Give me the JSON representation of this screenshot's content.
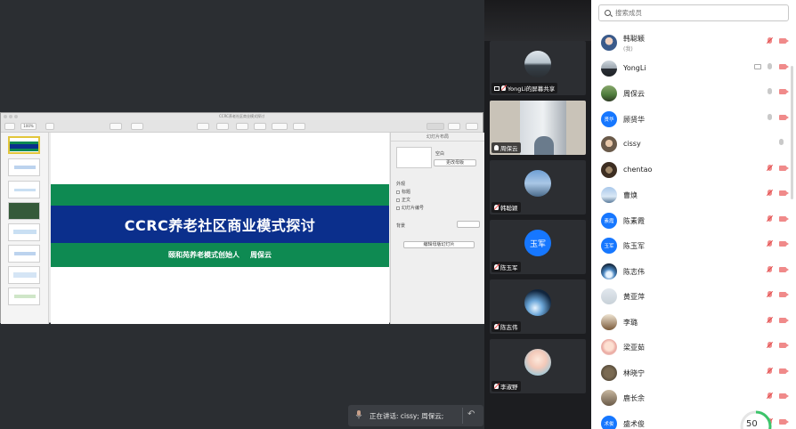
{
  "keynote": {
    "window_title": "CCRC养老社区商业模式探讨",
    "zoom": "100%",
    "inspector_title": "幻灯片布局",
    "layout_name": "空白",
    "change_master_label": "更改母版",
    "appearance_label": "外观",
    "checkboxes": [
      "标题",
      "正文",
      "幻灯片编号"
    ],
    "background_label": "背景",
    "edit_master_label": "编辑母版幻灯片"
  },
  "slide": {
    "title": "CCRC养老社区商业模式探讨",
    "subtitle_role": "颐和苑养老模式创始人",
    "subtitle_name": "周保云"
  },
  "speaking": {
    "text": "正在讲话: cissy; 周保云;"
  },
  "video_tiles": [
    {
      "name": "YongLi的屏幕共享"
    },
    {
      "name": "周保云"
    },
    {
      "name": "韩聪颖"
    },
    {
      "name": "陈玉军",
      "avatar_text": "玉军"
    },
    {
      "name": "陈志伟"
    },
    {
      "name": "李淑野"
    }
  ],
  "members": {
    "search_placeholder": "搜索成员",
    "list": [
      {
        "name": "韩聪颖",
        "sub": "(我)",
        "mic": "muted",
        "cam": "off"
      },
      {
        "name": "YongLi",
        "mic": "on",
        "cam": "off",
        "screen": true
      },
      {
        "name": "周保云",
        "mic": "on",
        "cam": "off"
      },
      {
        "name": "顾贤华",
        "avatar_text": "贤华",
        "mic": "on",
        "cam": "off"
      },
      {
        "name": "cissy",
        "mic": "on",
        "cam": "none"
      },
      {
        "name": "chentao",
        "mic": "muted",
        "cam": "off"
      },
      {
        "name": "曹焕",
        "mic": "muted",
        "cam": "off"
      },
      {
        "name": "陈素霞",
        "avatar_text": "素霞",
        "mic": "muted",
        "cam": "off"
      },
      {
        "name": "陈玉军",
        "avatar_text": "玉军",
        "mic": "muted",
        "cam": "off"
      },
      {
        "name": "陈志伟",
        "mic": "muted",
        "cam": "off"
      },
      {
        "name": "黄亚萍",
        "mic": "muted",
        "cam": "off"
      },
      {
        "name": "李璐",
        "mic": "muted",
        "cam": "off"
      },
      {
        "name": "梁亚茹",
        "mic": "muted",
        "cam": "off"
      },
      {
        "name": "林晓宁",
        "mic": "muted",
        "cam": "off"
      },
      {
        "name": "鹿长余",
        "mic": "muted",
        "cam": "off"
      },
      {
        "name": "盛术俊",
        "avatar_text": "术俊",
        "mic": "muted",
        "cam": "off"
      }
    ]
  },
  "progress_label": "50",
  "colors": {
    "slide_green": "#0e8a52",
    "slide_blue": "#0b2f8c",
    "avatar_blue": "#1677ff",
    "muted_red": "#e04444"
  }
}
